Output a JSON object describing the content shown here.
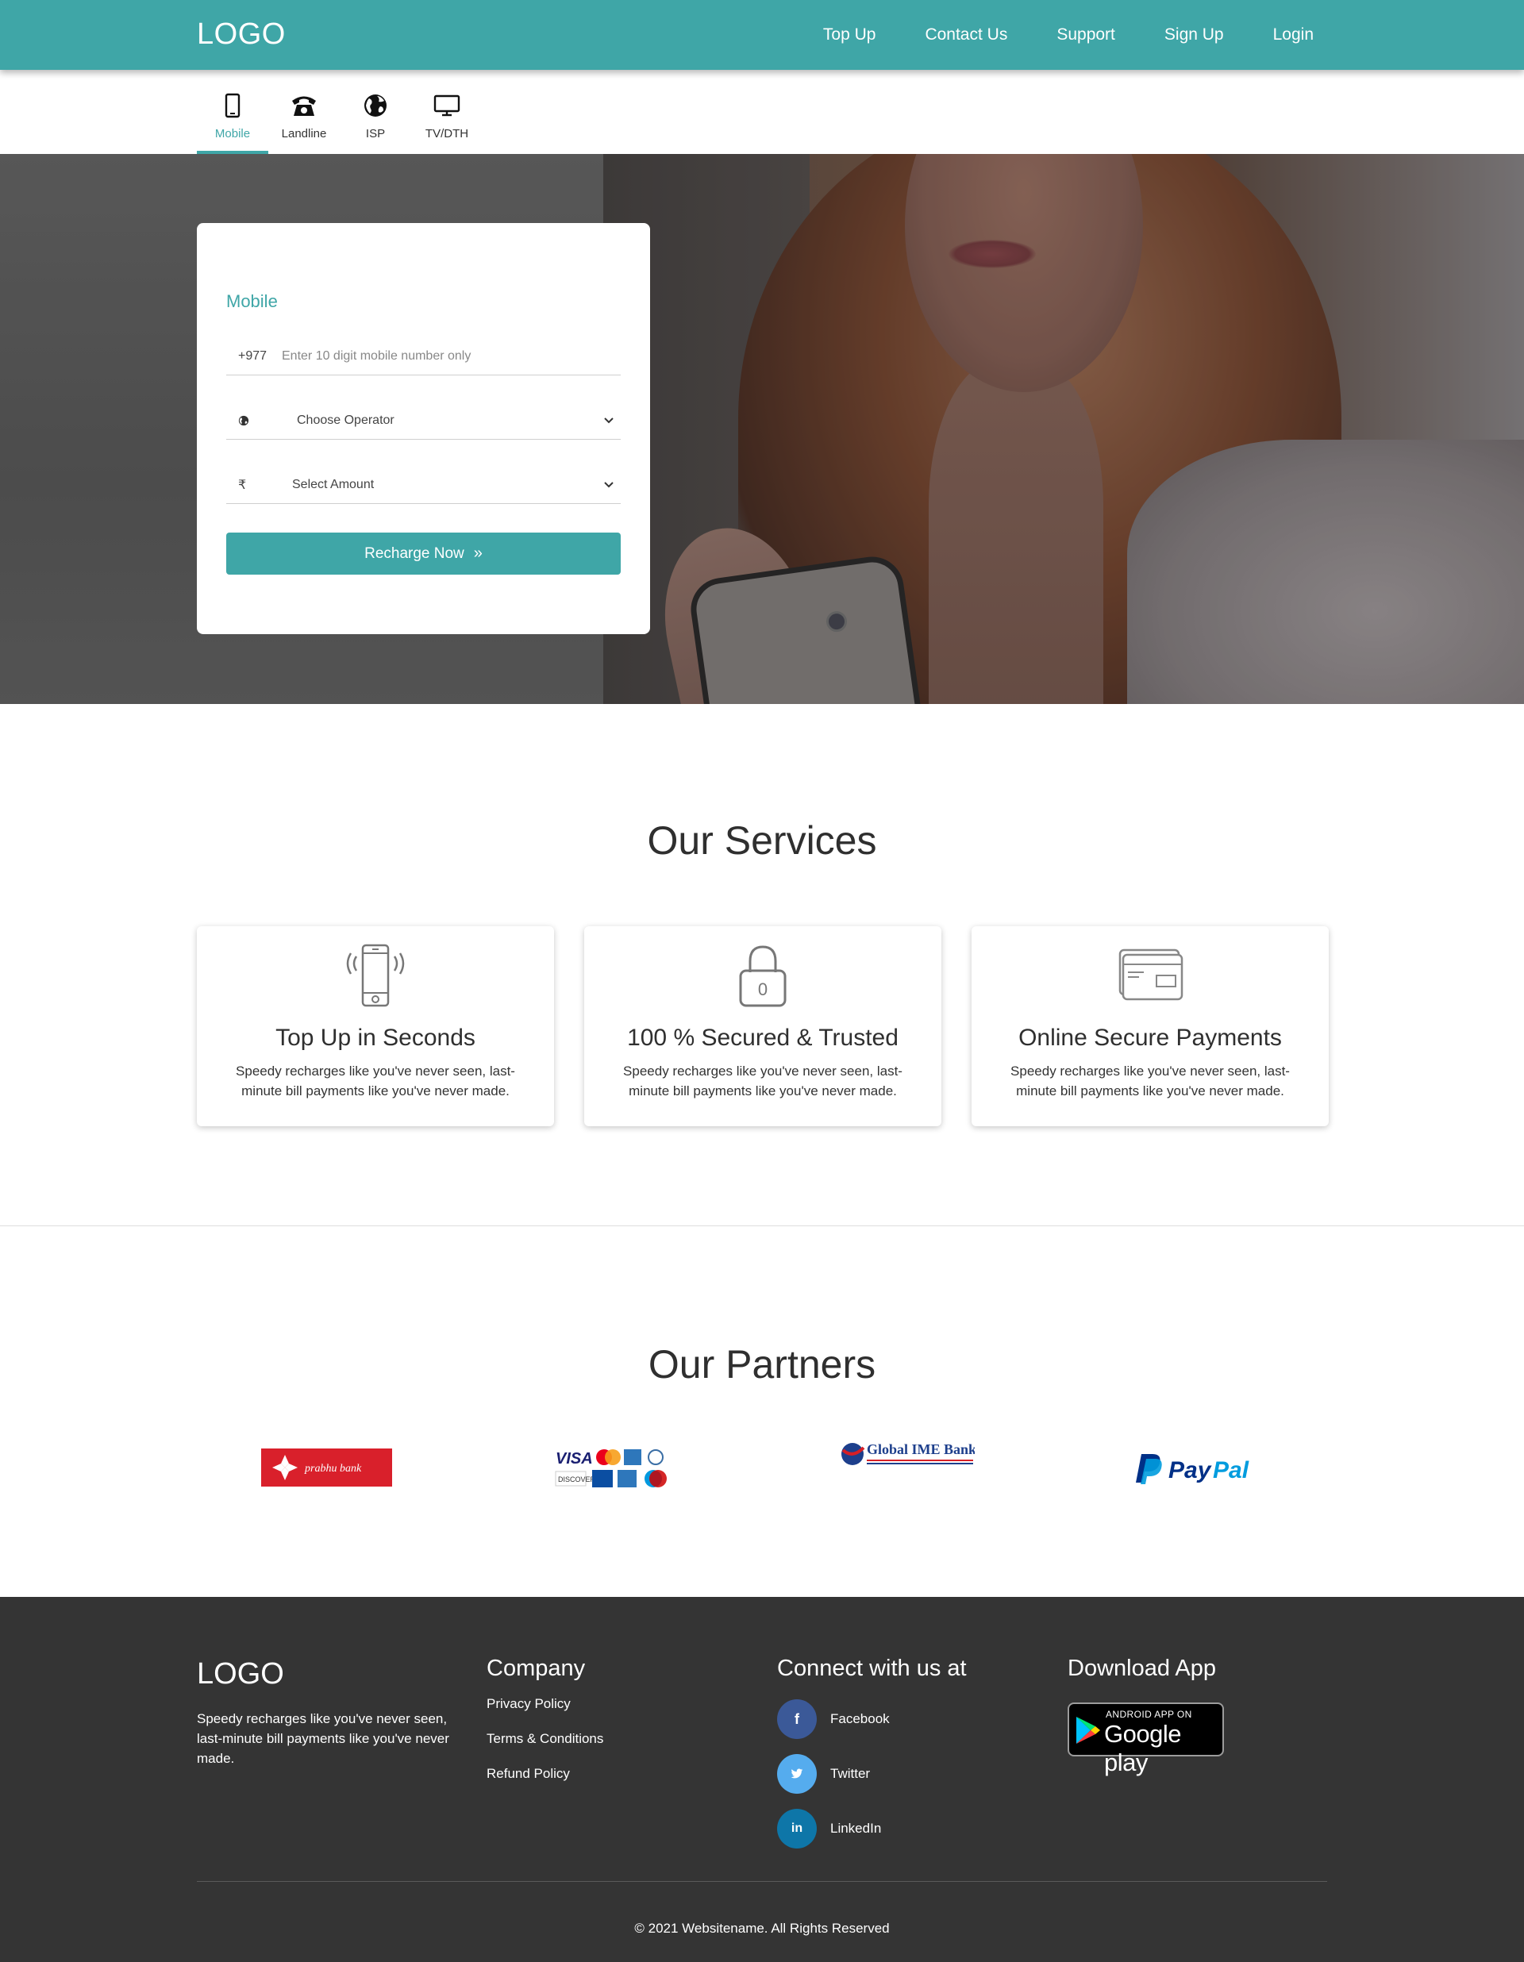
{
  "header": {
    "logo": "LOGO",
    "nav": [
      "Top Up",
      "Contact Us",
      "Support",
      "Sign Up",
      "Login"
    ]
  },
  "tabs": [
    {
      "label": "Mobile",
      "icon": "mobile-icon",
      "active": true
    },
    {
      "label": "Landline",
      "icon": "telephone-icon",
      "active": false
    },
    {
      "label": "ISP",
      "icon": "globe-icon",
      "active": false
    },
    {
      "label": "TV/DTH",
      "icon": "monitor-icon",
      "active": false
    }
  ],
  "recharge": {
    "title": "Mobile",
    "country_code": "+977",
    "phone_placeholder": "Enter 10 digit mobile number only",
    "operator_value": "Choose Operator",
    "amount_value": "Select Amount",
    "currency_symbol": "₹",
    "button_label": "Recharge Now",
    "button_icon": "»"
  },
  "services": {
    "title": "Our Services",
    "items": [
      {
        "title": "Top Up in Seconds",
        "desc": "Speedy recharges like you've never seen, last-minute bill payments like you've never made.",
        "icon": "phone-vibrate-icon"
      },
      {
        "title": "100 % Secured & Trusted",
        "desc": "Speedy recharges like you've never seen, last-minute bill payments like you've never made.",
        "icon": "padlock-icon"
      },
      {
        "title": "Online Secure Payments",
        "desc": "Speedy recharges like you've never seen, last-minute bill payments like you've never made.",
        "icon": "credit-card-icon"
      }
    ]
  },
  "partners": {
    "title": "Our Partners",
    "logos": [
      {
        "name": "prabhu bank",
        "icon": "prabhu-bank-logo"
      },
      {
        "name": "card networks",
        "icon": "card-networks-logo"
      },
      {
        "name": "Global IME Bank",
        "icon": "global-ime-bank-logo"
      },
      {
        "name": "PayPal",
        "icon": "paypal-logo"
      }
    ]
  },
  "footer": {
    "logo": "LOGO",
    "desc": "Speedy recharges like you've never seen, last-minute bill payments like you've never made.",
    "company_title": "Company",
    "company_links": [
      "Privacy Policy",
      "Terms & Conditions",
      "Refund Policy"
    ],
    "connect_title": "Connect with us at",
    "social": [
      {
        "label": "Facebook",
        "glyph": "f",
        "color": "#3b5998"
      },
      {
        "label": "Twitter",
        "glyph": "t",
        "color": "#55acee"
      },
      {
        "label": "LinkedIn",
        "glyph": "in",
        "color": "#0e76a8"
      }
    ],
    "download_title": "Download App",
    "gplay_top": "ANDROID APP ON",
    "gplay_main": "Google play",
    "copyright": "© 2021 Websitename. All Rights Reserved"
  },
  "colors": {
    "accent": "#3fa6a7",
    "footer": "#343434"
  }
}
